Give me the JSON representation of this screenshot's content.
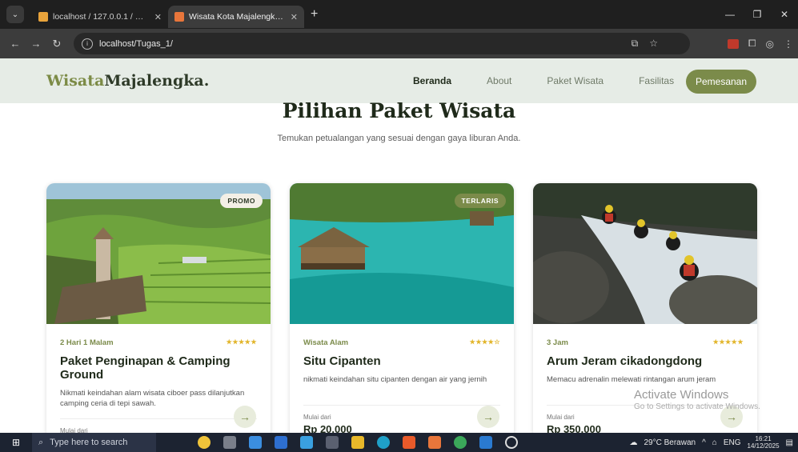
{
  "browser": {
    "tabs": [
      {
        "title": "localhost / 127.0.0.1 / wisata_di",
        "active": false
      },
      {
        "title": "Wisata Kota Majalengka - Natu",
        "active": true
      }
    ],
    "url": "localhost/Tugas_1/"
  },
  "site": {
    "logo_accent": "Wisata",
    "logo_rest": "Majalengka.",
    "nav": [
      "Beranda",
      "About",
      "Paket Wisata",
      "Fasilitas"
    ],
    "cta": "Pemesanan"
  },
  "section": {
    "title": "Pilihan Paket Wisata",
    "subtitle": "Temukan petualangan yang sesuai dengan gaya liburan Anda."
  },
  "cards": [
    {
      "badge": "PROMO",
      "meta": "2 Hari 1 Malam",
      "stars": "★★★★★",
      "title": "Paket Penginapan & Camping Ground",
      "desc": "Nikmati keindahan alam wisata ciboer pass dilanjutkan camping ceria di tepi sawah.",
      "from": "Mulai dari",
      "price": ""
    },
    {
      "badge": "TERLARIS",
      "meta": "Wisata Alam",
      "stars": "★★★★☆",
      "title": "Situ Cipanten",
      "desc": "nikmati keindahan situ cipanten dengan air yang jernih",
      "from": "Mulai dari",
      "price": "Rp 20.000"
    },
    {
      "badge": "",
      "meta": "3 Jam",
      "stars": "★★★★★",
      "title": "Arum Jeram cikadongdong",
      "desc": "Memacu adrenalin melewati rintangan arum jeram",
      "from": "Mulai dari",
      "price": "Rp 350.000"
    }
  ],
  "watermark": {
    "line1": "Activate Windows",
    "line2": "Go to Settings to activate Windows."
  },
  "taskbar": {
    "search": "Type here to search",
    "weather": "29°C  Berawan",
    "lang": "ENG",
    "time": "16:21",
    "date": "14/12/2025"
  },
  "colors": {
    "accent": "#7b8b4a",
    "nav_bg": "#e6ece6",
    "star": "#e2b52a"
  }
}
